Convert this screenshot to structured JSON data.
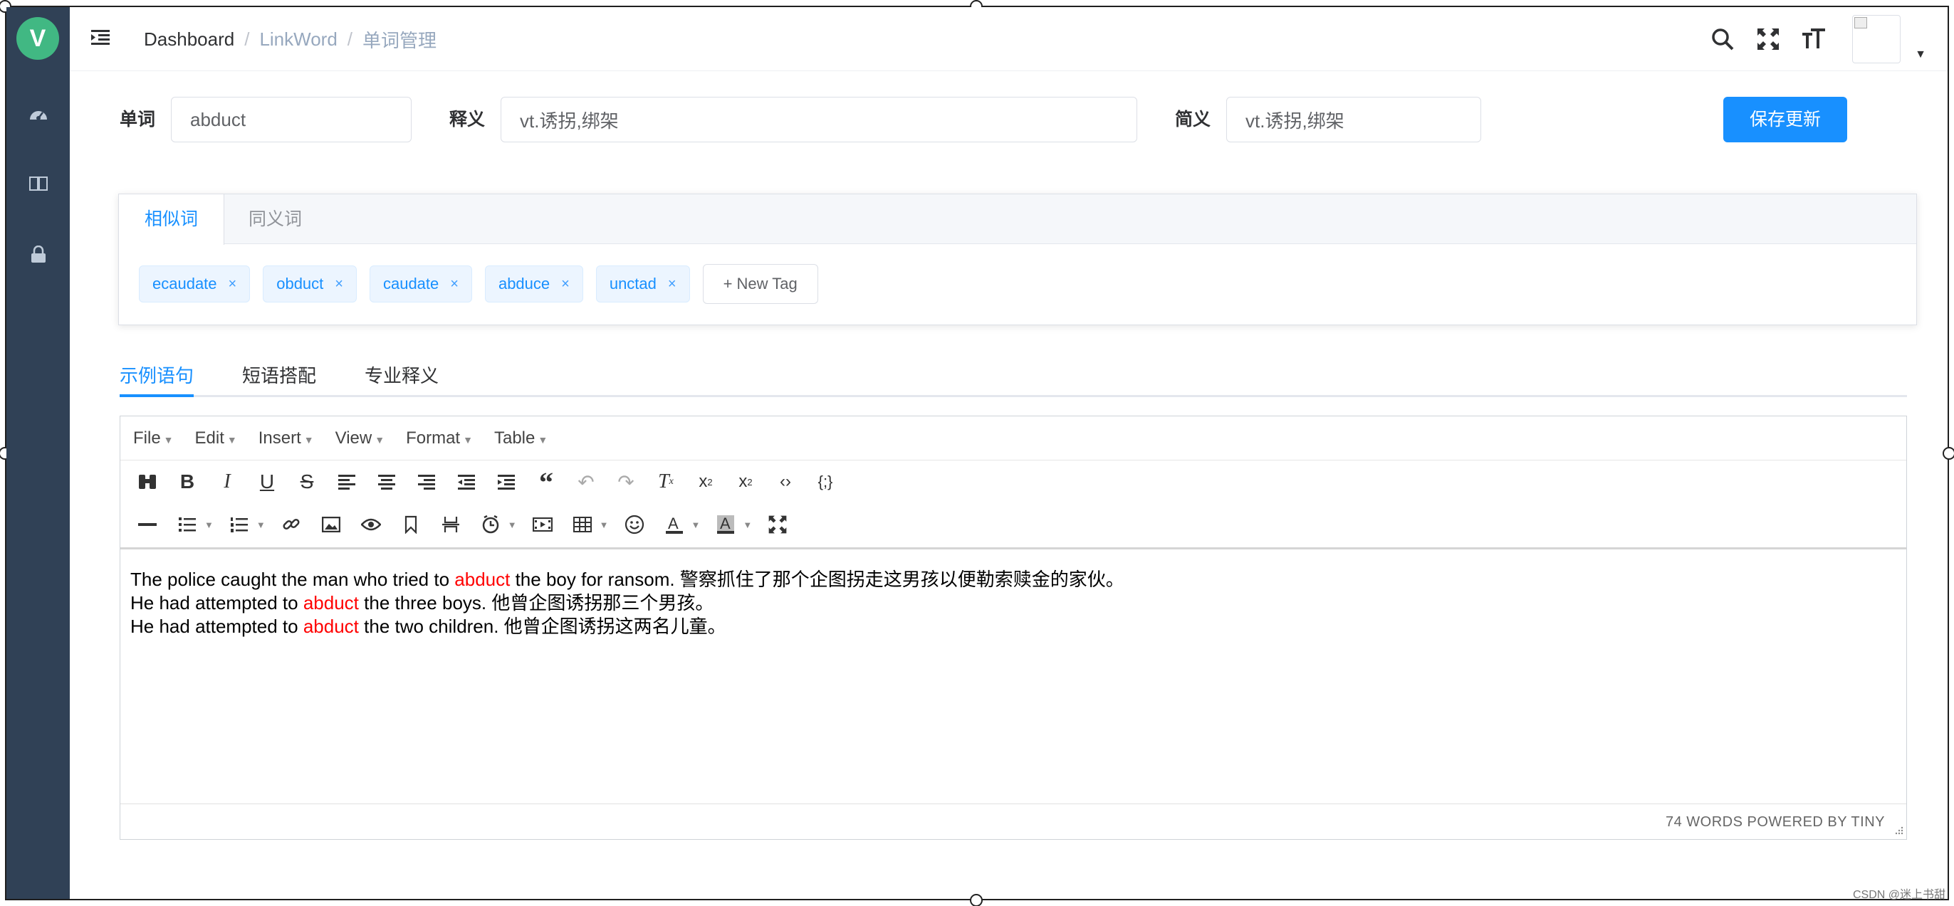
{
  "app": {
    "logo_letter": "V"
  },
  "navbar": {
    "breadcrumb": [
      "Dashboard",
      "LinkWord",
      "单词管理"
    ],
    "breadcrumb_sep": "/"
  },
  "form": {
    "word_label": "单词",
    "word_value": "abduct",
    "definition_label": "释义",
    "definition_value": "vt.诱拐,绑架",
    "brief_label": "简义",
    "brief_value": "vt.诱拐,绑架",
    "save_label": "保存更新"
  },
  "tag_card": {
    "tabs": [
      "相似词",
      "同义词"
    ],
    "tags": [
      "ecaudate",
      "obduct",
      "caudate",
      "abduce",
      "unctad"
    ],
    "close_glyph": "×",
    "new_tag_label": "+ New Tag"
  },
  "example_tabs": [
    "示例语句",
    "短语搭配",
    "专业释义"
  ],
  "editor": {
    "menus": [
      "File",
      "Edit",
      "Insert",
      "View",
      "Format",
      "Table"
    ],
    "lines": [
      {
        "pre": "The police caught the man who tried to ",
        "word": "abduct",
        "post": " the boy for ransom.   警察抓住了那个企图拐走这男孩以便勒索赎金的家伙。"
      },
      {
        "pre": "He had attempted to ",
        "word": "abduct",
        "post": " the three boys.   他曾企图诱拐那三个男孩。"
      },
      {
        "pre": "He had attempted to ",
        "word": "abduct",
        "post": " the two children.   他曾企图诱拐这两名儿童。"
      }
    ],
    "status": "74 WORDS POWERED BY TINY"
  },
  "watermark": "CSDN @迷上书甜",
  "colors": {
    "sidebar": "#304156",
    "primary": "#1890ff",
    "highlight": "#ff0000",
    "logo": "#41b883"
  }
}
